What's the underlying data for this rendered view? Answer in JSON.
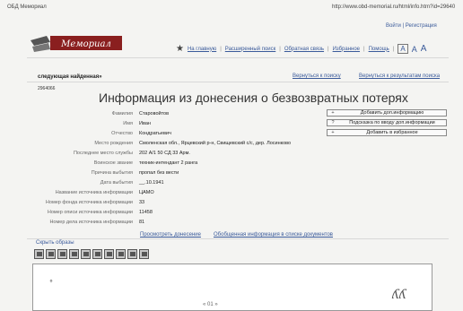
{
  "print_header": {
    "left": "ОБД Мемориал",
    "right": "http://www.obd-memorial.ru/html/info.htm?id=29640"
  },
  "logo": {
    "text": "Мемориал"
  },
  "login": {
    "login_label": "Войти",
    "sep": "|",
    "register_label": "Регистрация"
  },
  "nav": {
    "home": "На главную",
    "advanced_search": "Расширенный поиск",
    "feedback": "Обратная связь",
    "favorites": "Избранное",
    "help": "Помощь",
    "font_sizes": [
      "A",
      "A",
      "A"
    ]
  },
  "results_nav": {
    "next_found": "следующая найденная»",
    "back_to_search": "Вернуться к поиску",
    "back_to_results": "Вернуться к результатам поиска"
  },
  "record_id": "2964066",
  "page_title": "Информация из донесения о безвозвратных потерях",
  "fields": [
    {
      "label": "Фамилия",
      "value": "Старовойтов"
    },
    {
      "label": "Имя",
      "value": "Иван"
    },
    {
      "label": "Отчество",
      "value": "Кондратьевич"
    },
    {
      "label": "Место рождения",
      "value": "Смоленская обл., Ярцевский р-н, Свищевский с/с, дер. Лосинково"
    },
    {
      "label": "Последнее место службы",
      "value": "202 А/1 50 СД 33 Арм."
    },
    {
      "label": "Воинское звание",
      "value": "техник-интендант 2 ранга"
    },
    {
      "label": "Причина выбытия",
      "value": "пропал без вести"
    },
    {
      "label": "Дата выбытия",
      "value": "__.10.1941"
    },
    {
      "label": "Название источника информации",
      "value": "ЦАМО"
    },
    {
      "label": "Номер фонда источника информации",
      "value": "33"
    },
    {
      "label": "Номер описи источника информации",
      "value": "11458"
    },
    {
      "label": "Номер дела источника информации",
      "value": "81"
    }
  ],
  "actions": [
    {
      "icon": "+",
      "label": "Добавить доп.информацию"
    },
    {
      "icon": "?",
      "label": "Подсказка по вводу доп.информации"
    },
    {
      "icon": "+",
      "label": "Добавить в избранное"
    }
  ],
  "bottom_links": {
    "view_report": "Просмотреть донесение",
    "general_info": "Обобщенная информация в списке документов"
  },
  "hide_images": "Скрыть образы",
  "toolbar_icons": [
    "fit-page-icon",
    "rotate-icon",
    "zoom-in-icon",
    "zoom-out-icon",
    "actual-size-icon",
    "fit-width-icon",
    "print-icon",
    "save-icon",
    "first-page-icon",
    "next-page-icon"
  ],
  "pager": "« 01 »",
  "colors": {
    "link": "#3a5a9a",
    "background": "#f4f4f2"
  }
}
